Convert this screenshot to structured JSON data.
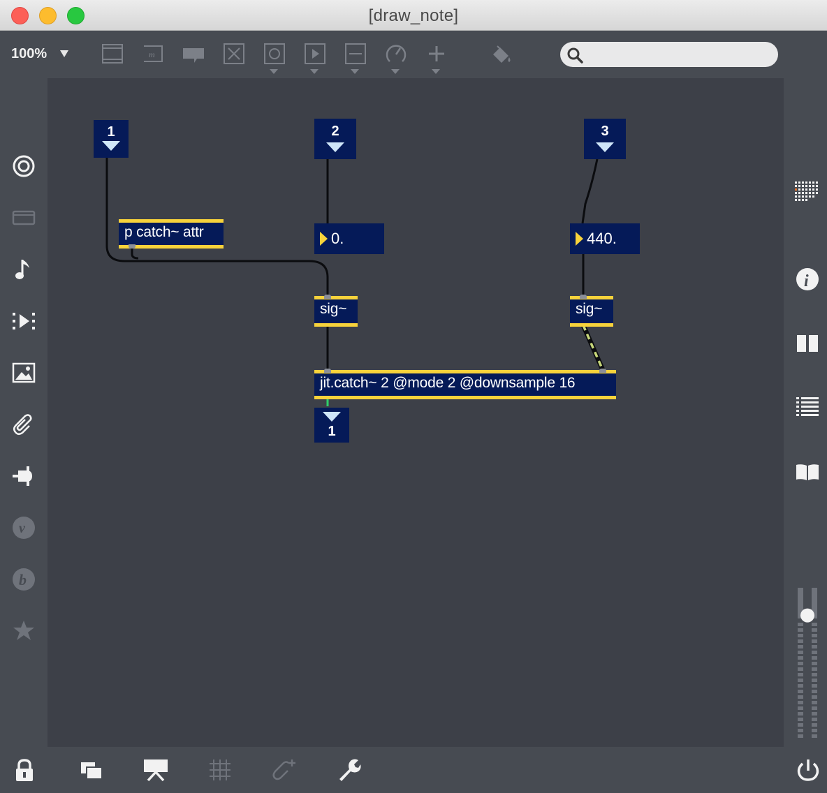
{
  "window": {
    "title": "[draw_note]"
  },
  "toolbar": {
    "zoom": "100%",
    "search_placeholder": "",
    "icons": [
      "object-box-icon",
      "message-box-icon",
      "comment-icon",
      "button-icon",
      "toggle-icon",
      "play-icon",
      "slider-icon",
      "dial-icon",
      "add-object-icon",
      "paint-bucket-icon"
    ]
  },
  "patch": {
    "inlets": [
      {
        "label": "1"
      },
      {
        "label": "2"
      },
      {
        "label": "3"
      }
    ],
    "objects": {
      "subpatch": "p catch~ attr",
      "sig_left": "sig~",
      "sig_right": "sig~",
      "jit_catch": "jit.catch~ 2 @mode 2 @downsample 16"
    },
    "numbers": {
      "left": "0.",
      "right": "440."
    },
    "outlet": {
      "label": "1"
    }
  },
  "left_sidebar": [
    "target-icon",
    "presentation-icon",
    "music-note-icon",
    "video-icon",
    "image-icon",
    "paperclip-icon",
    "plug-icon",
    "v-icon",
    "b-icon",
    "star-icon"
  ],
  "right_sidebar": [
    "grid-icon",
    "info-icon",
    "split-view-icon",
    "list-icon",
    "book-icon"
  ],
  "audio_level": 0.82,
  "bottom_bar": [
    "lock-icon",
    "windows-icon",
    "presentation-mode-icon",
    "grid-toggle-icon",
    "attach-icon",
    "wrench-icon",
    "power-icon"
  ],
  "colors": {
    "object_bg": "#051a58",
    "object_stripe": "#f7d23b",
    "canvas": "#3d4048",
    "chrome": "#474b52"
  }
}
